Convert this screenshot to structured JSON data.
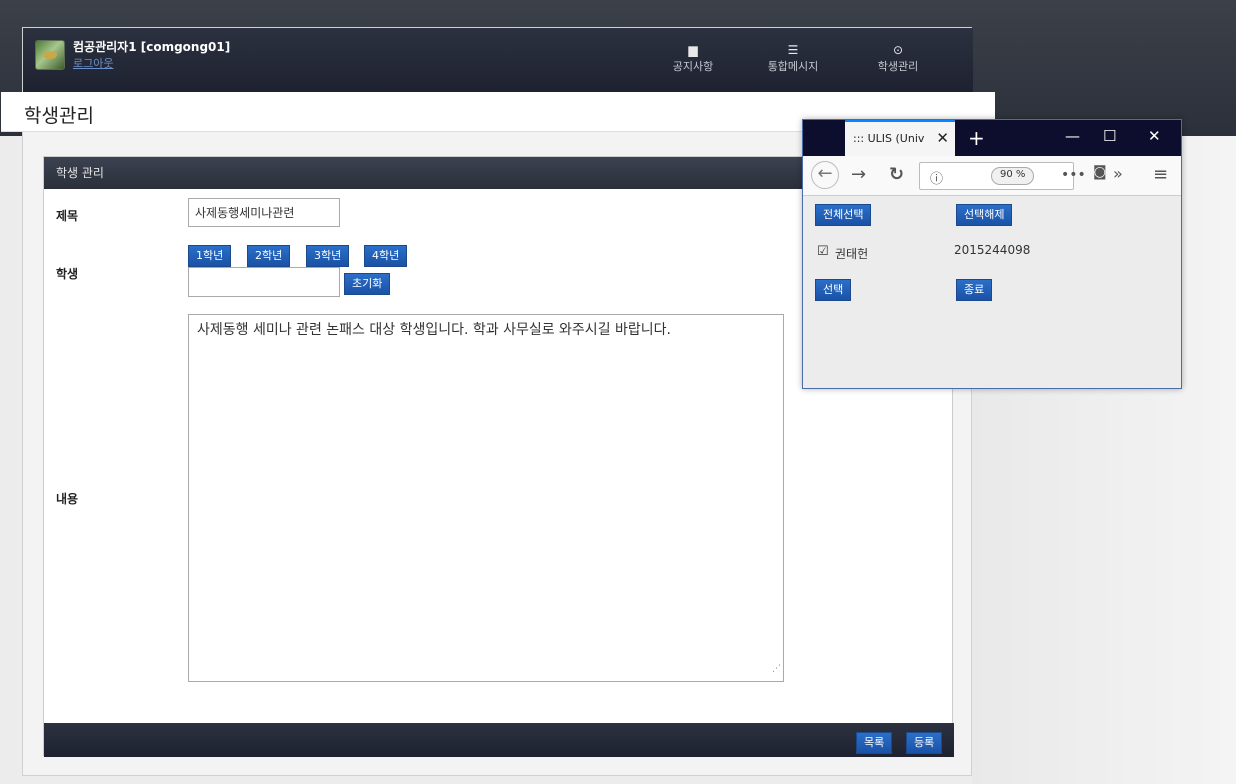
{
  "header": {
    "username": "컴공관리자1 [comgong01]",
    "logout": "로그아웃",
    "nav": [
      {
        "label": "공지사항",
        "icon": "notice-icon"
      },
      {
        "label": "통합메시지",
        "icon": "list-icon"
      },
      {
        "label": "학생관리",
        "icon": "circle-check-icon"
      }
    ]
  },
  "page_title": "학생관리",
  "panel": {
    "title": "학생 관리",
    "subject_label": "제목",
    "subject_value": "사제동행세미나관련",
    "student_label": "학생",
    "grades": [
      "1학년",
      "2학년",
      "3학년",
      "4학년"
    ],
    "student_input": "",
    "reset_label": "초기화",
    "content_label": "내용",
    "content_value": "사제동행 세미나 관련 논패스 대상 학생입니다. 학과 사무실로 와주시길 바랍니다.",
    "list_label": "목록",
    "register_label": "등록"
  },
  "popup": {
    "tab_title": "::: ULIS (Univ",
    "zoom": "90 %",
    "select_all": "전체선택",
    "deselect": "선택해제",
    "student_name": "권태헌",
    "student_id": "2015244098",
    "student_checked": true,
    "select": "선택",
    "close": "종료"
  }
}
